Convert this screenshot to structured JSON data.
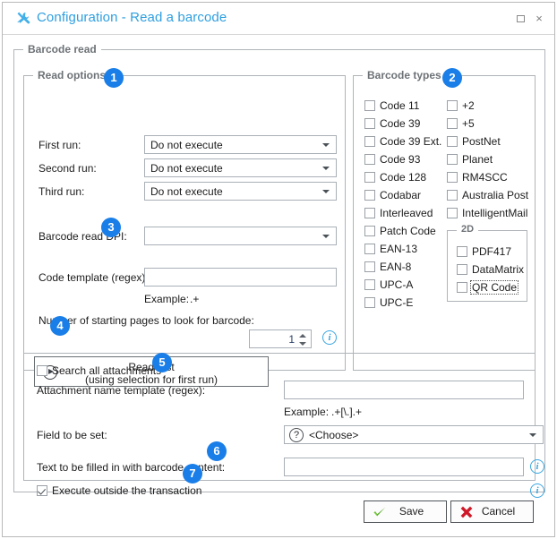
{
  "window": {
    "title": "Configuration - Read a barcode",
    "icon": "tools-icon",
    "maximize_label": "Maximize",
    "close_label": "×",
    "accent_color": "#2f9fe0",
    "badge_color": "#1a7ee8"
  },
  "groups": {
    "barcode_read": "Barcode read",
    "read_options": "Read options",
    "barcode_types": "Barcode types",
    "two_d": "2D"
  },
  "read_options": {
    "rows": [
      {
        "label": "First run:",
        "value": "Do not execute"
      },
      {
        "label": "Second run:",
        "value": "Do not execute"
      },
      {
        "label": "Third run:",
        "value": "Do not execute"
      }
    ],
    "dpi_label": "Barcode read DPI:",
    "dpi_value": "",
    "code_template_label": "Code template (regex):",
    "code_template_value": "",
    "example_label": "Example:",
    "example_value": ".+",
    "pages_label": "Number of starting pages to look for barcode:",
    "pages_value": "1",
    "read_test_line1": "Read test",
    "read_test_line2": "(using selection for first run)",
    "read_test_icon": "play-circle-icon",
    "pages_info_icon": "info-icon"
  },
  "barcode_types": {
    "column1": [
      {
        "label": "Code 11",
        "checked": false
      },
      {
        "label": "Code 39",
        "checked": false
      },
      {
        "label": "Code 39 Ext.",
        "checked": false
      },
      {
        "label": "Code 93",
        "checked": false
      },
      {
        "label": "Code 128",
        "checked": false
      },
      {
        "label": "Codabar",
        "checked": false
      },
      {
        "label": "Interleaved",
        "checked": false
      },
      {
        "label": "Patch Code",
        "checked": false
      },
      {
        "label": "EAN-13",
        "checked": false
      },
      {
        "label": "EAN-8",
        "checked": false
      },
      {
        "label": "UPC-A",
        "checked": false
      },
      {
        "label": "UPC-E",
        "checked": false
      }
    ],
    "column2": [
      {
        "label": "+2",
        "checked": false
      },
      {
        "label": "+5",
        "checked": false
      },
      {
        "label": "PostNet",
        "checked": false
      },
      {
        "label": "Planet",
        "checked": false
      },
      {
        "label": "RM4SCC",
        "checked": false
      },
      {
        "label": "Australia Post",
        "checked": false
      },
      {
        "label": "IntelligentMail",
        "checked": false
      }
    ],
    "two_d": [
      {
        "label": "PDF417",
        "checked": false,
        "focused": false
      },
      {
        "label": "DataMatrix",
        "checked": false,
        "focused": false
      },
      {
        "label": "QR Code",
        "checked": false,
        "focused": true
      }
    ]
  },
  "bottom": {
    "search_all_attachments": {
      "label": "Search all attachments",
      "checked": false
    },
    "attachment_template_label": "Attachment name template (regex):",
    "attachment_template_value": "",
    "attachment_example_label": "Example:",
    "attachment_example_value": ".+[\\.].+",
    "field_to_be_set_label": "Field to be set:",
    "field_to_be_set_value": "<Choose>",
    "field_to_be_set_icon": "question-circle-icon",
    "text_filled_label": "Text to be filled in with barcode content:",
    "text_filled_value": "",
    "execute_outside": {
      "label": "Execute outside the transaction",
      "checked": true
    },
    "info_icon": "info-icon"
  },
  "footer": {
    "save_label": "Save",
    "save_icon": "green-check-icon",
    "cancel_label": "Cancel",
    "cancel_icon": "red-cross-icon"
  },
  "badges": [
    "1",
    "2",
    "3",
    "4",
    "5",
    "6",
    "7"
  ]
}
